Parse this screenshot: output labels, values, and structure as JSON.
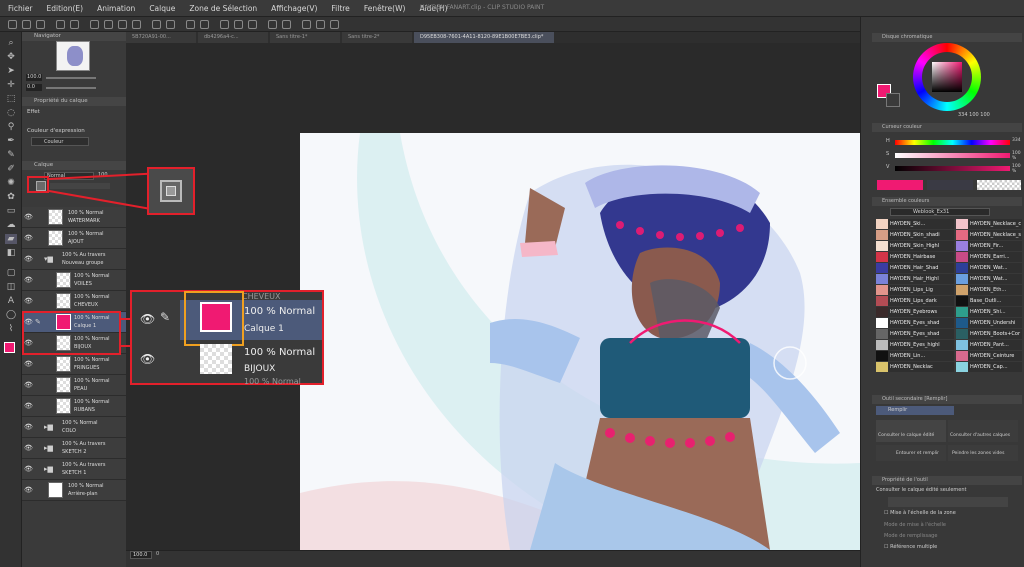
{
  "menu": [
    "Fichier",
    "Edition(E)",
    "Animation",
    "Calque",
    "Zone de Sélection",
    "Affichage(V)",
    "Filtre",
    "Fenêtre(W)",
    "Aide(H)"
  ],
  "window_title": "HAYDEN FANART.clip - CLIP STUDIO PAINT",
  "tabs": [
    "5B720A91-00...",
    "db4296a4-c...",
    "Sans titre-1*",
    "Sans titre-2*",
    "D95EB308-7601-4A11-8120-89E1B00E7BE3.clip*"
  ],
  "navigator": {
    "title": "Navigator",
    "zoom": "100.0",
    "rotate": "0.0"
  },
  "tool_property": {
    "title": "Propriété du calque",
    "effect_label": "Effet",
    "expression_label": "Couleur d'expression",
    "expression_value": "Couleur"
  },
  "layers": {
    "title": "Calque",
    "blend": "Normal",
    "opacity": "100",
    "items": [
      {
        "mode": "100 % Normal",
        "name": "WATERMARK"
      },
      {
        "mode": "100 % Normal",
        "name": "AJOUT"
      },
      {
        "mode": "100 % Au travers",
        "name": "Nouveau groupe"
      },
      {
        "mode": "100 % Normal",
        "name": "VOILES"
      },
      {
        "mode": "100 % Normal",
        "name": "CHEVEUX"
      },
      {
        "mode": "100 % Normal",
        "name": "Calque 1"
      },
      {
        "mode": "100 % Normal",
        "name": "BIJOUX"
      },
      {
        "mode": "100 % Normal",
        "name": "FRINGUES"
      },
      {
        "mode": "100 % Normal",
        "name": "PEAU"
      },
      {
        "mode": "100 % Normal",
        "name": "RUBANS"
      },
      {
        "mode": "100 % Normal",
        "name": "COLO"
      },
      {
        "mode": "100 % Au travers",
        "name": "SKETCH 2"
      },
      {
        "mode": "100 % Au travers",
        "name": "SKETCH 1"
      },
      {
        "mode": "100 % Normal",
        "name": "Arrière-plan"
      }
    ]
  },
  "callout": {
    "row1_mode": "100 % Normal",
    "row1_name": "Calque 1",
    "row2_mode": "100 % Normal",
    "row2_name": "BIJOUX",
    "top_text": "CHEVEUX",
    "bottom_text": "100 % Normal"
  },
  "status": {
    "zoom": "100.0",
    "value": "0"
  },
  "color_wheel": {
    "title": "Disque chromatique",
    "readout": "334 100 100"
  },
  "color_slider": {
    "title": "Curseur couleur",
    "rows": [
      {
        "label": "H",
        "value": "334"
      },
      {
        "label": "S",
        "value": "100 %"
      },
      {
        "label": "V",
        "value": "100 %"
      }
    ]
  },
  "colors": {
    "main": "#f01a72",
    "accent_red": "#e3202b",
    "selection": "#4c5a7a"
  },
  "color_set": {
    "title": "Ensemble couleurs",
    "set_name": "Weblook_Ex31",
    "left": [
      "HAYDEN_Ski...",
      "HAYDEN_Skin_shadi",
      "HAYDEN_Skin_Highl",
      "HAYDEN_Hairbase",
      "HAYDEN_Hair_Shad",
      "HAYDEN_Hair_Highl",
      "HAYDEN_Lips_Lig",
      "HAYDEN_Lips_dark",
      "HAYDEN_Eyebrows",
      "HAYDEN_Eyes_shad",
      "HAYDEN_Eyes_shad",
      "HAYDEN_Eyes_highl",
      "HAYDEN_Lin...",
      "HAYDEN_Necklac"
    ],
    "right": [
      "HAYDEN_Necklace_c",
      "HAYDEN_Necklace_s",
      "HAYDEN_Fir...",
      "HAYDEN_Earri...",
      "HAYDEN_Wat...",
      "HAYDEN_Wat...",
      "HAYDEN_Eth...",
      "Base_Outli...",
      "HAYDEN_Shi...",
      "HAYDEN_Undershi",
      "HAYDEN_Boots+Cor",
      "HAYDEN_Pant...",
      "HAYDEN_Ceinture",
      "HAYDEN_Cap..."
    ],
    "left_colors": [
      "#f2d3c2",
      "#d79e86",
      "#f5e0d1",
      "#d43548",
      "#3a3ca3",
      "#7a82d8",
      "#e2958c",
      "#b34c54",
      "#3a2a2a",
      "#ffffff",
      "#666666",
      "#bbbbbb",
      "#111111",
      "#d9c36b"
    ],
    "right_colors": [
      "#f2c3ca",
      "#e56a82",
      "#9a7fe0",
      "#c84b86",
      "#2d3f99",
      "#6a9fe0",
      "#cfa26b",
      "#111111",
      "#2e9e8c",
      "#1e5a8a",
      "#2a5f63",
      "#7ec1e0",
      "#d86a8e",
      "#8ad3e0"
    ]
  },
  "sub_tool": {
    "title": "Outil secondaire [Remplir]",
    "active": "Remplir",
    "items": [
      "Consulter le calque édité",
      "Consulter d'autres calques",
      "Entourer et remplir",
      "Peindre les zones vides"
    ]
  },
  "tool_props": {
    "title": "Propriété de l'outil",
    "mode_label": "Consulter le calque édité seulement",
    "rows": [
      "Mise à l'échelle de la zone",
      "Mode de mise à l'échelle",
      "Mode de remplissage",
      "Référence multiple"
    ]
  }
}
